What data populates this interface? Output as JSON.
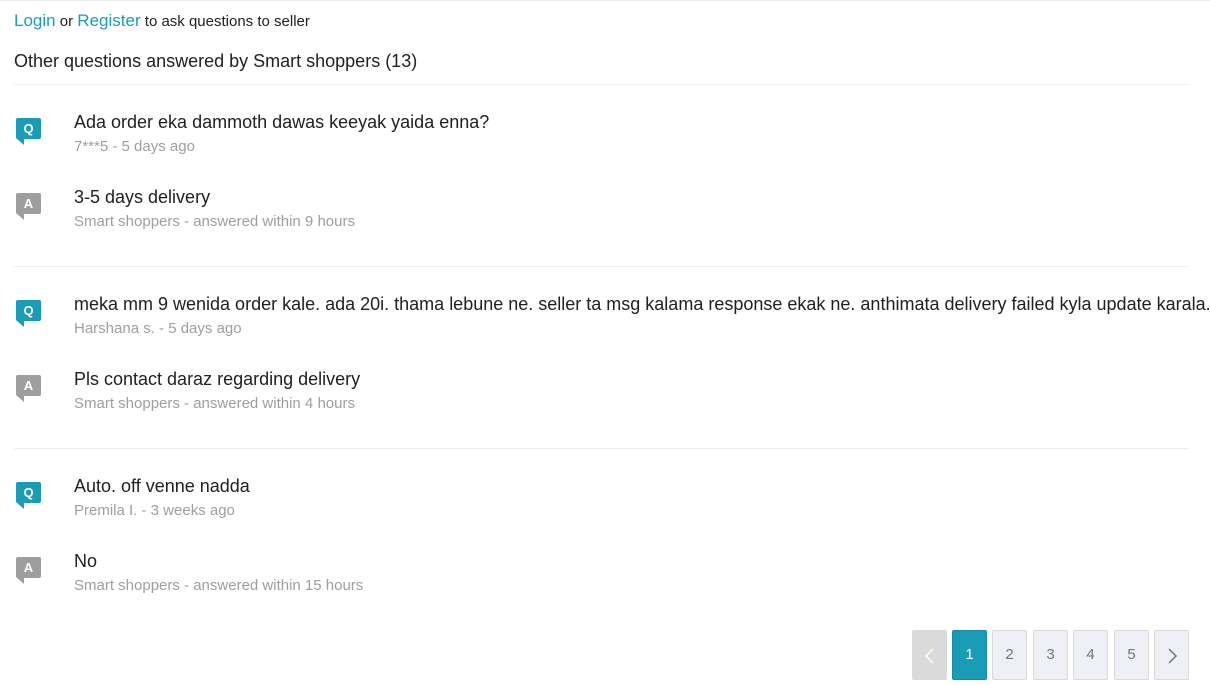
{
  "auth": {
    "login": "Login",
    "or": "or",
    "register": "Register",
    "suffix": "to ask questions to seller"
  },
  "section_title": "Other questions answered by Smart shoppers (13)",
  "qa": [
    {
      "q_badge": "Q",
      "question": "Ada order eka dammoth dawas keeyak yaida enna?",
      "asker": "7***5 - 5 days ago",
      "a_badge": "A",
      "answer": "3-5 days delivery",
      "answered": "Smart shoppers - answered within 9 hours"
    },
    {
      "q_badge": "Q",
      "question": "meka mm 9 wenida order kale. ada 20i. thama lebune ne. seller ta msg kalama response ekak ne. anthimata delivery failed kyla update karala..",
      "asker": "Harshana s. - 5 days ago",
      "a_badge": "A",
      "answer": "Pls contact daraz regarding delivery",
      "answered": "Smart shoppers - answered within 4 hours"
    },
    {
      "q_badge": "Q",
      "question": "Auto. off venne nadda",
      "asker": "Premila I. - 3 weeks ago",
      "a_badge": "A",
      "answer": "No",
      "answered": "Smart shoppers - answered within 15 hours"
    }
  ],
  "pagination": {
    "prev_icon": "chevron-left-icon",
    "next_icon": "chevron-right-icon",
    "pages": [
      "1",
      "2",
      "3",
      "4",
      "5"
    ],
    "current": "1"
  },
  "colors": {
    "accent": "#1a9cb7",
    "answer_badge": "#9e9e9e",
    "meta_text": "#9e9e9e"
  }
}
